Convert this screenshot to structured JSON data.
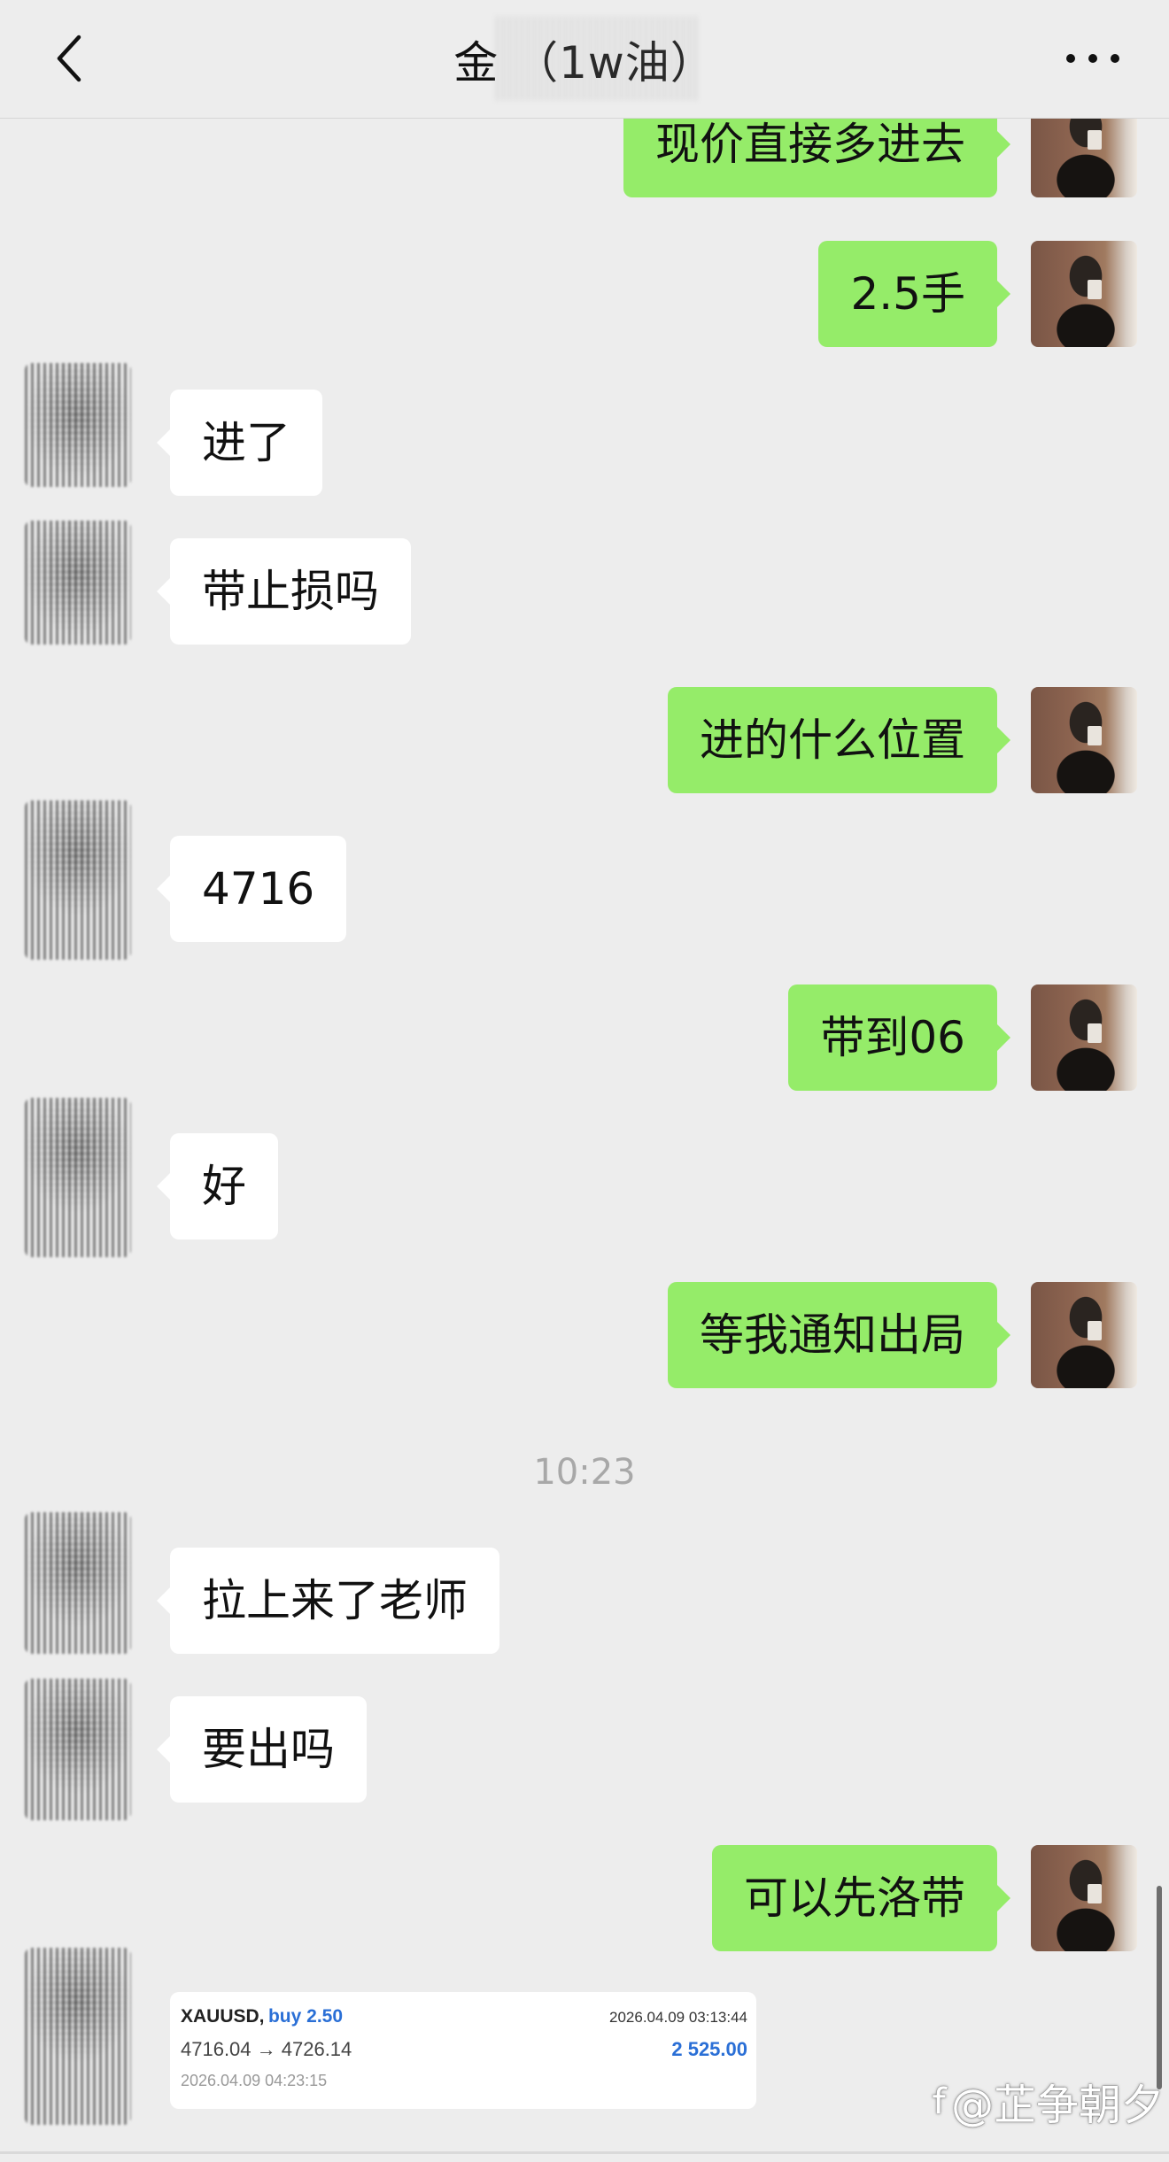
{
  "header": {
    "title": "金 （1w油）"
  },
  "messages": [
    {
      "side": "me",
      "text": "现价直接多进去"
    },
    {
      "side": "me",
      "text": "2.5手"
    },
    {
      "side": "other",
      "text": "进了"
    },
    {
      "side": "other",
      "text": "带止损吗"
    },
    {
      "side": "me",
      "text": "进的什么位置"
    },
    {
      "side": "other",
      "text": "4716"
    },
    {
      "side": "me",
      "text": "带到06"
    },
    {
      "side": "other",
      "text": "好"
    },
    {
      "side": "me",
      "text": "等我通知出局"
    },
    {
      "side": "other",
      "text": "拉上来了老师"
    },
    {
      "side": "other",
      "text": "要出吗"
    },
    {
      "side": "me",
      "text": "可以先洛带"
    }
  ],
  "timestamp": "10:23",
  "trade_card": {
    "symbol": "XAUUSD,",
    "side": "buy 2.50",
    "open_time": "2026.04.09 03:13:44",
    "price_range": "4716.04 → 4726.14",
    "profit": "2 525.00",
    "close_time": "2026.04.09 04:23:15"
  },
  "watermark": {
    "icon": "weibo-logo-icon",
    "text": "@芷争朝夕"
  }
}
